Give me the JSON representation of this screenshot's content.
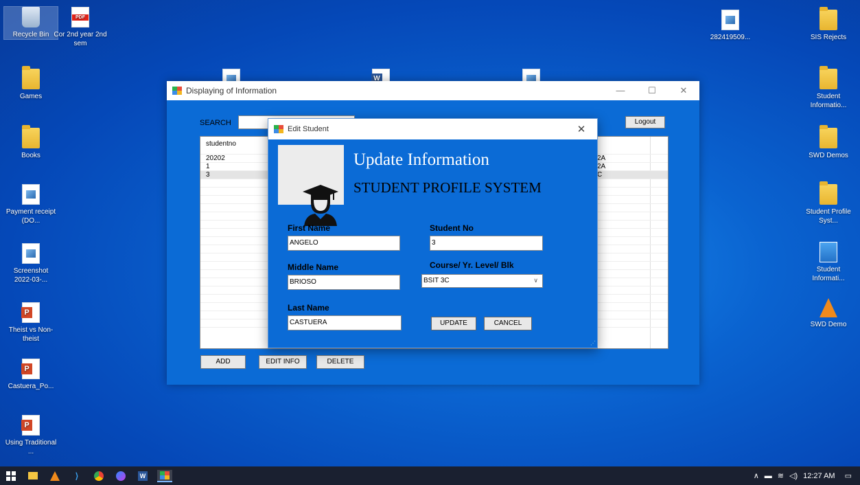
{
  "desktop": {
    "left_icons": [
      {
        "label": "Recycle Bin",
        "type": "recycle"
      },
      {
        "label": "Cor 2nd year 2nd sem",
        "type": "pdf"
      },
      {
        "label": "Games",
        "type": "folder"
      },
      {
        "label": "Books",
        "type": "folder"
      },
      {
        "label": "Payment receipt (DO...",
        "type": "image"
      },
      {
        "label": "Screenshot 2022-03-...",
        "type": "image"
      },
      {
        "label": "Theist vs Non-theist",
        "type": "ppt"
      },
      {
        "label": "Castuera_Po...",
        "type": "ppt"
      },
      {
        "label": "Using Traditional ...",
        "type": "ppt"
      }
    ],
    "right_icons": [
      {
        "label": "282419509...",
        "type": "image"
      },
      {
        "label": "SIS Rejects",
        "type": "folder"
      },
      {
        "label": "Student Informatio...",
        "type": "folder"
      },
      {
        "label": "SWD Demos",
        "type": "folder"
      },
      {
        "label": "Student Profile Syst...",
        "type": "folder"
      },
      {
        "label": "Student Informati...",
        "type": "shortcut"
      },
      {
        "label": "SWD Demo",
        "type": "vlc"
      }
    ]
  },
  "main_window": {
    "title": "Displaying of Information",
    "search_label": "SEARCH",
    "logout_label": "Logout",
    "grid": {
      "header": "studentno",
      "rows": [
        {
          "studentno": "20202",
          "right": "2A"
        },
        {
          "studentno": "1",
          "right": "2A"
        },
        {
          "studentno": "3",
          "right": "C"
        }
      ]
    },
    "buttons": {
      "add": "ADD",
      "edit": "EDIT INFO",
      "delete": "DELETE"
    }
  },
  "dialog": {
    "title": "Edit Student",
    "heading": "Update Information",
    "subheading": "STUDENT PROFILE SYSTEM",
    "first_name_label": "First Name",
    "first_name": "ANGELO",
    "middle_name_label": "Middle Name",
    "middle_name": "BRIOSO",
    "last_name_label": "Last Name",
    "last_name": "CASTUERA",
    "student_no_label": "Student No",
    "student_no": "3",
    "course_label": "Course/ Yr. Level/ Blk",
    "course": "BSIT 3C",
    "update_label": "UPDATE",
    "cancel_label": "CANCEL"
  },
  "taskbar": {
    "time": "12:27 AM"
  }
}
